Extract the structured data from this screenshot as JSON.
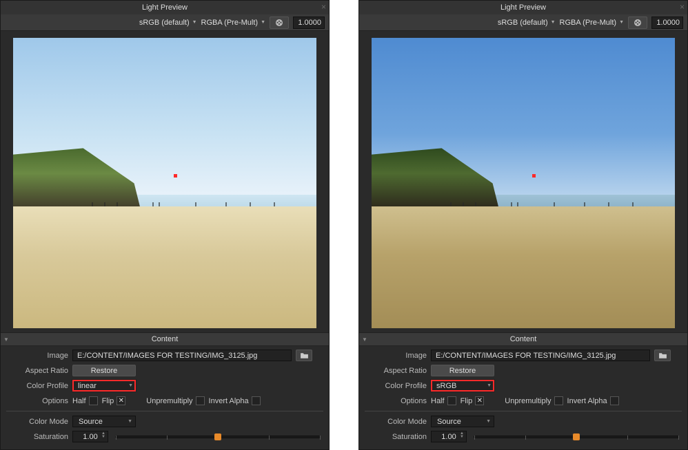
{
  "panels": [
    {
      "title": "Light Preview",
      "toolbar": {
        "profile": "sRGB (default)",
        "channels": "RGBA (Pre-Mult)",
        "zoom": "1.0000"
      },
      "marker": {
        "left_pct": 53,
        "top_pct": 47
      },
      "content_header": "Content",
      "image": {
        "label": "Image",
        "path": "E:/CONTENT/IMAGES FOR TESTING/IMG_3125.jpg"
      },
      "aspect": {
        "label": "Aspect Ratio",
        "button": "Restore"
      },
      "profile_row": {
        "label": "Color Profile",
        "value": "linear",
        "highlight": true
      },
      "options": {
        "label": "Options",
        "half": "Half",
        "half_on": false,
        "flip": "Flip",
        "flip_on": true,
        "unpre": "Unpremultiply",
        "unpre_on": false,
        "invert": "Invert Alpha",
        "invert_on": false
      },
      "mode": {
        "label": "Color Mode",
        "value": "Source"
      },
      "sat": {
        "label": "Saturation",
        "value": "1.00",
        "pos_pct": 50
      },
      "img_class": "linear"
    },
    {
      "title": "Light Preview",
      "toolbar": {
        "profile": "sRGB (default)",
        "channels": "RGBA (Pre-Mult)",
        "zoom": "1.0000"
      },
      "marker": {
        "left_pct": 53,
        "top_pct": 47
      },
      "content_header": "Content",
      "image": {
        "label": "Image",
        "path": "E:/CONTENT/IMAGES FOR TESTING/IMG_3125.jpg"
      },
      "aspect": {
        "label": "Aspect Ratio",
        "button": "Restore"
      },
      "profile_row": {
        "label": "Color Profile",
        "value": "sRGB",
        "highlight": true
      },
      "options": {
        "label": "Options",
        "half": "Half",
        "half_on": false,
        "flip": "Flip",
        "flip_on": true,
        "unpre": "Unpremultiply",
        "unpre_on": false,
        "invert": "Invert Alpha",
        "invert_on": false
      },
      "mode": {
        "label": "Color Mode",
        "value": "Source"
      },
      "sat": {
        "label": "Saturation",
        "value": "1.00",
        "pos_pct": 50
      },
      "img_class": "srgb"
    }
  ]
}
